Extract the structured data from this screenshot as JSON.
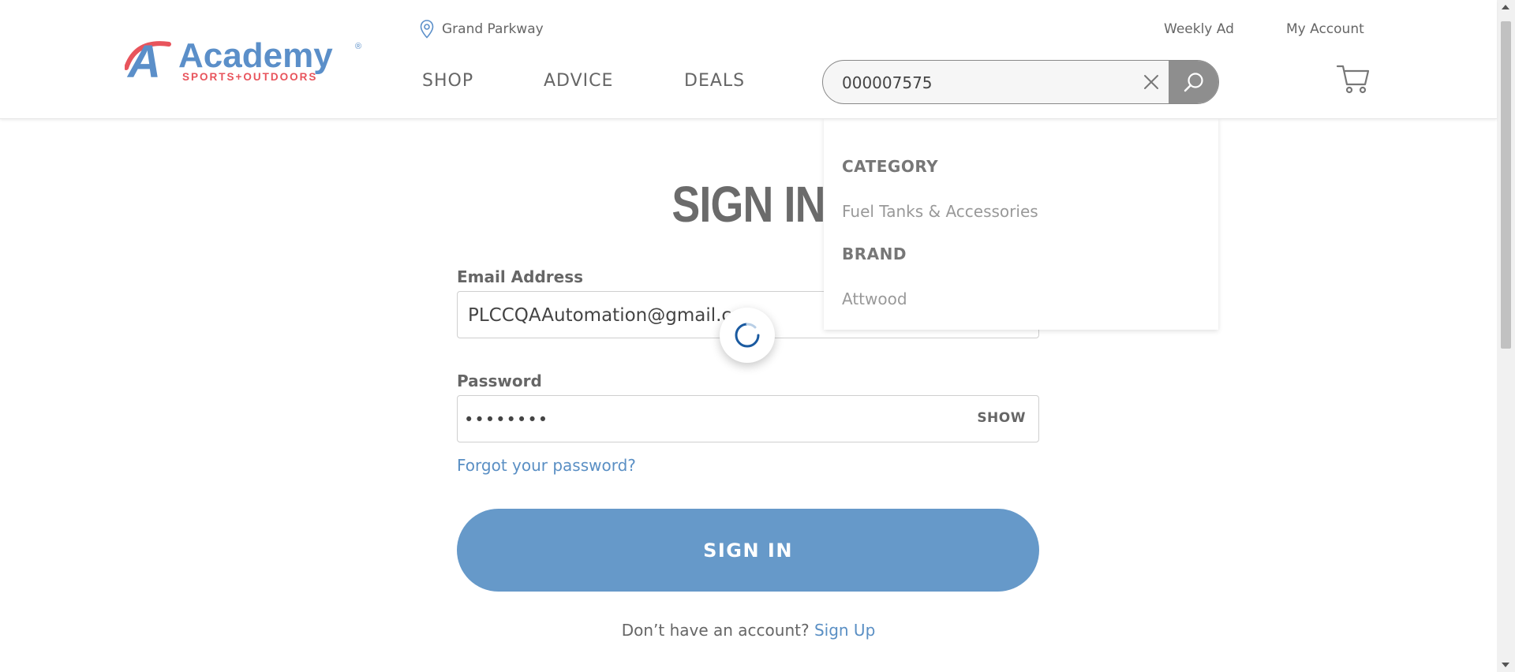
{
  "header": {
    "logo": {
      "name": "Academy",
      "tagline": "SPORTS+OUTDOORS",
      "registered": "®",
      "brand_blue": "#5b8fc9",
      "brand_red": "#e8545c"
    },
    "location": {
      "icon": "map-pin-icon",
      "label": "Grand Parkway"
    },
    "util_links": {
      "weekly_ad": "Weekly Ad",
      "my_account": "My Account"
    },
    "nav": {
      "shop": "SHOP",
      "advice": "ADVICE",
      "deals": "DEALS"
    },
    "search": {
      "value": "000007575",
      "clear_icon": "close-icon",
      "submit_icon": "search-icon"
    },
    "cart_icon": "cart-icon"
  },
  "search_suggestions": {
    "category_heading": "CATEGORY",
    "category_item": "Fuel Tanks & Accessories",
    "brand_heading": "BRAND",
    "brand_item": "Attwood"
  },
  "signin_form": {
    "title": "SIGN IN",
    "email_label": "Email Address",
    "email_value": "PLCCQAAutomation@gmail.com",
    "password_label": "Password",
    "password_value": "••••••••",
    "show_label": "SHOW",
    "forgot_link": "Forgot your password?",
    "submit_label": "SIGN IN",
    "no_account_text": "Don’t have an account?",
    "signup_link": "Sign Up",
    "accent_color": "#6699c9"
  },
  "loading_indicator": {
    "icon": "spinner-icon",
    "accent": "#1a5aa0"
  }
}
